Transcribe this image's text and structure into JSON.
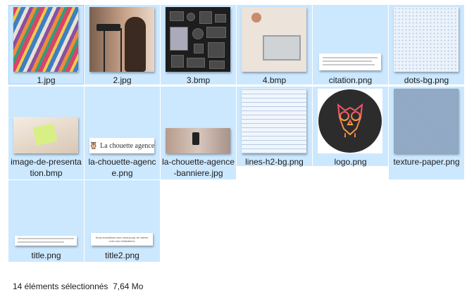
{
  "files": [
    {
      "name": "1.jpg",
      "thumb": "magazines-photo"
    },
    {
      "name": "2.jpg",
      "thumb": "camera-photo"
    },
    {
      "name": "3.bmp",
      "thumb": "tech-flatlay-photo"
    },
    {
      "name": "4.bmp",
      "thumb": "desk-laptop-photo"
    },
    {
      "name": "citation.png",
      "thumb": "quote-image"
    },
    {
      "name": "dots-bg.png",
      "thumb": "dots-pattern"
    },
    {
      "name": "image-de-presentation.bmp",
      "thumb": "presentation-photo"
    },
    {
      "name": "la-chouette-agence.png",
      "thumb": "logo-text-image",
      "thumb_text": "La chouette agence"
    },
    {
      "name": "la-chouette-agence-banniere.jpg",
      "thumb": "banner-photo"
    },
    {
      "name": "lines-h2-bg.png",
      "thumb": "lines-pattern"
    },
    {
      "name": "logo.png",
      "thumb": "owl-logo"
    },
    {
      "name": "texture-paper.png",
      "thumb": "paper-texture"
    },
    {
      "name": "title.png",
      "thumb": "title-image"
    },
    {
      "name": "title2.png",
      "thumb": "title2-image",
      "thumb_text": "Nous travaillons avec beaucoup de clients\nvoici nos réalisations"
    }
  ],
  "selection_color": "#cce8ff",
  "status_bar": {
    "count": "14 éléments sélectionnés",
    "size": "7,64 Mo"
  }
}
